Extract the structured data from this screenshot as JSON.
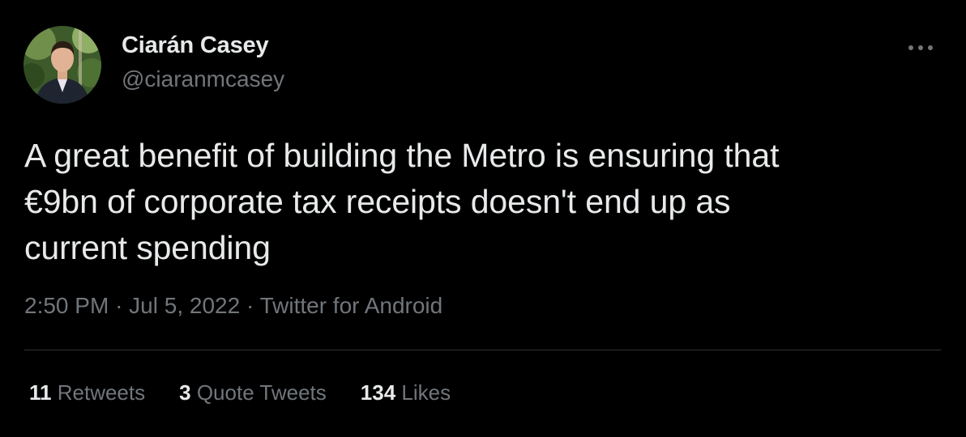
{
  "tweet": {
    "display_name": "Ciarán Casey",
    "handle": "@ciaranmcasey",
    "text_lines": [
      "A great benefit of building the Metro is ensuring that",
      "€9bn of corporate tax receipts doesn't end up as",
      "current spending"
    ],
    "time": "2:50 PM",
    "separator": "·",
    "date": "Jul 5, 2022",
    "source": "Twitter for Android",
    "more_icon": "more-horizontal-icon",
    "avatar_icon": "profile-photo"
  },
  "stats": {
    "retweets_count": "11",
    "retweets_label": "Retweets",
    "quotes_count": "3",
    "quotes_label": "Quote Tweets",
    "likes_count": "134",
    "likes_label": "Likes"
  },
  "colors": {
    "background": "#000000",
    "primary_text": "#e7e9ea",
    "secondary_text": "#71767b",
    "divider": "#2f3336"
  }
}
